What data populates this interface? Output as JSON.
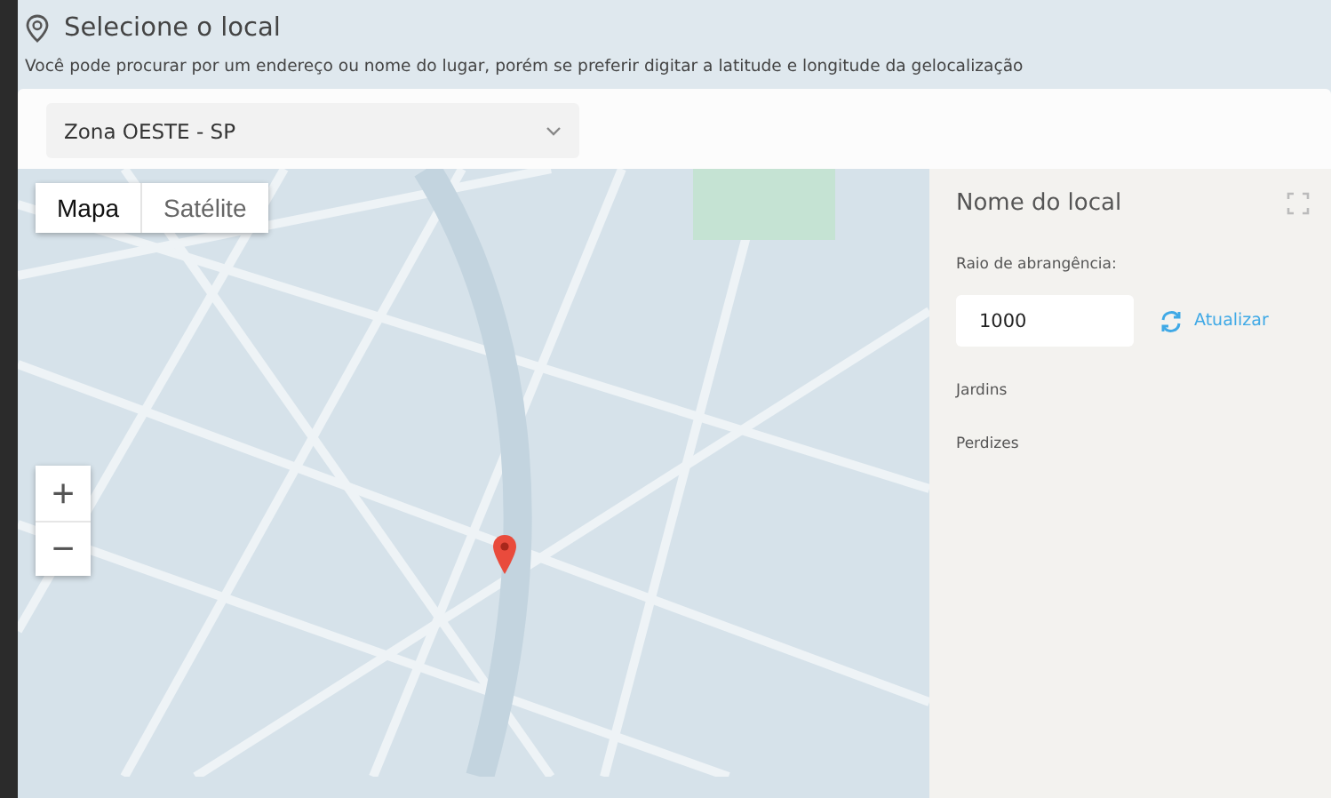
{
  "dialog": {
    "title": "Selecione o local",
    "description": "Você pode procurar por um endereço ou nome do lugar, porém se preferir digitar a latitude e longitude da gelocalização",
    "location_select": {
      "value": "Zona OESTE - SP"
    }
  },
  "map": {
    "map_types": [
      {
        "label": "Mapa",
        "selected": true
      },
      {
        "label": "Satélite",
        "selected": false
      }
    ],
    "zoom_controls": [
      "+",
      "−"
    ]
  },
  "side_panel": {
    "title": "Nome do local",
    "radius_label": "Raio de abrangência:",
    "radius_value": "1000",
    "refresh_label": "Atualizar",
    "places": [
      "Jardins",
      "Perdizes"
    ]
  }
}
